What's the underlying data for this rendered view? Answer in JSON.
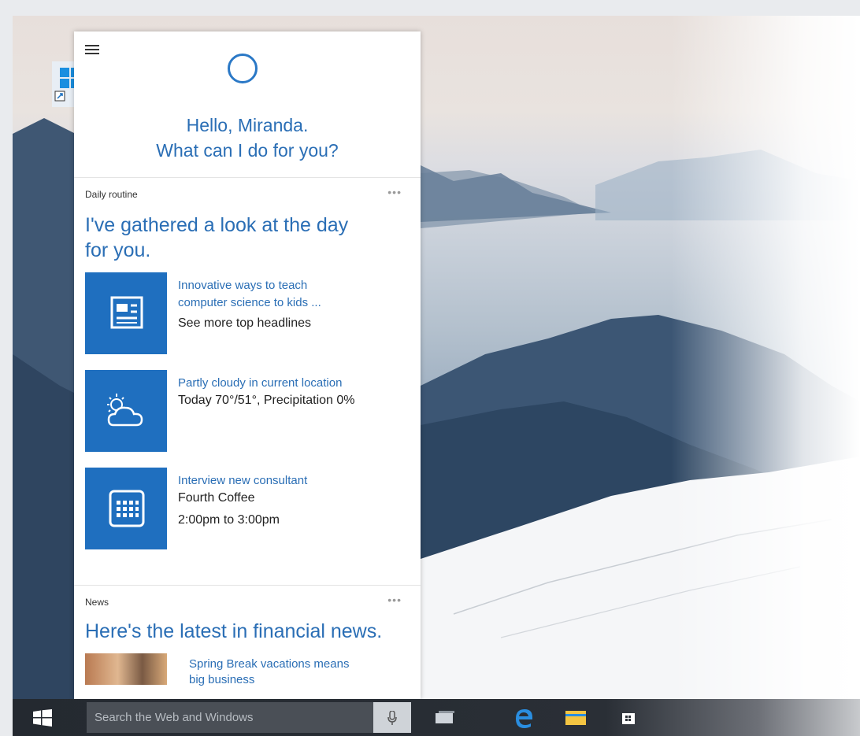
{
  "cortana": {
    "greeting_line1": "Hello, Miranda.",
    "greeting_line2": "What can I do for you?",
    "daily": {
      "label": "Daily routine",
      "more": "•••",
      "title_line1": "I've gathered a look at the day",
      "title_line2": "for you.",
      "items": [
        {
          "icon": "news-icon",
          "line1": "Innovative ways to teach",
          "line1b": "computer science to kids ...",
          "line2": "See more top headlines"
        },
        {
          "icon": "weather-icon",
          "line1": "Partly cloudy in current location",
          "line2": "Today 70°/51°, Precipitation 0%"
        },
        {
          "icon": "calendar-icon",
          "line1": "Interview new consultant",
          "line2": "Fourth Coffee",
          "line3": "2:00pm to 3:00pm"
        }
      ]
    },
    "news": {
      "label": "News",
      "more": "•••",
      "title": "Here's the latest in financial news.",
      "item_line1": "Spring Break vacations means",
      "item_line2": "big business"
    }
  },
  "taskbar": {
    "search_placeholder": "Search the Web and Windows",
    "icons": [
      "windows-start-icon",
      "microphone-icon",
      "task-view-icon",
      "edge-browser-icon",
      "file-explorer-icon",
      "store-icon"
    ]
  },
  "colors": {
    "accent": "#2a6eb5",
    "tile": "#1f6fbf",
    "taskbar": "#242930"
  }
}
